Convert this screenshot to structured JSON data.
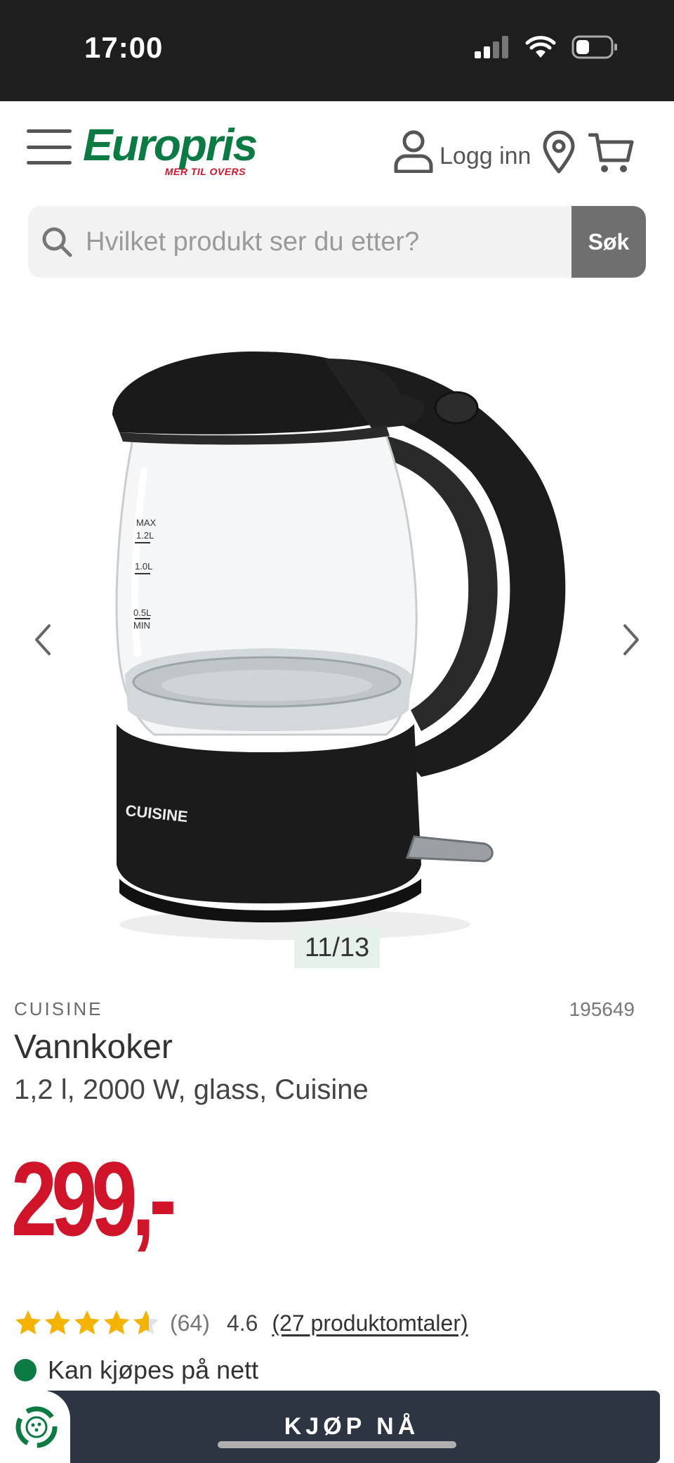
{
  "status_bar": {
    "time": "17:00"
  },
  "header": {
    "logo_text": "Europris",
    "logo_tagline": "MER TIL OVERS",
    "login_label": "Logg inn",
    "icons": [
      "menu-icon",
      "user-icon",
      "location-pin-icon",
      "cart-icon"
    ]
  },
  "search": {
    "placeholder": "Hvilket produkt ser du etter?",
    "button_label": "Søk"
  },
  "gallery": {
    "counter": "11/13",
    "kettle_markings": [
      "MAX",
      "1.2L",
      "1.0L",
      "0.5L",
      "MIN"
    ],
    "kettle_brand_print": "CUISINE"
  },
  "product": {
    "brand": "CUISINE",
    "sku": "195649",
    "title": "Vannkoker",
    "subtitle": "1,2 l, 2000 W, glass, Cuisine",
    "price": "299,-",
    "rating_count": "(64)",
    "rating_avg": "4.6",
    "rating_value": 4.6,
    "rating_max": 5,
    "reviews_link": "(27 produktomtaler)",
    "availability": "Kan kjøpes på nett"
  },
  "actions": {
    "buy_label": "KJØP NÅ"
  },
  "colors": {
    "brand_green": "#0b7a43",
    "price_red": "#d0152b",
    "star_gold": "#f5b301",
    "buy_button": "#2d3442"
  }
}
